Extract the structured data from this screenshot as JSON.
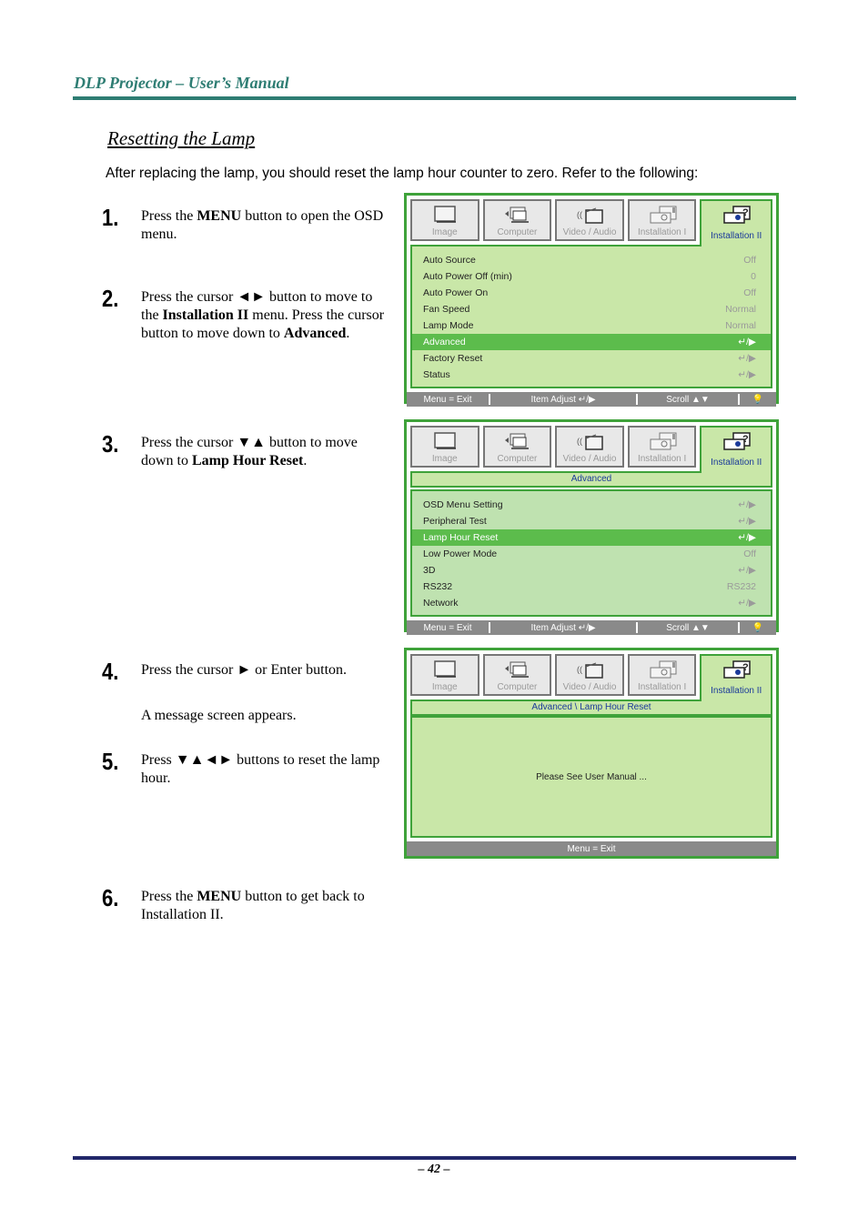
{
  "header": {
    "title": "DLP Projector – User’s Manual"
  },
  "section": {
    "title": "Resetting the Lamp",
    "intro": "After replacing the lamp, you should reset the lamp hour counter to zero. Refer to the following:"
  },
  "steps": [
    {
      "num": "1.",
      "parts": [
        "Press the ",
        "MENU",
        " button to open the OSD menu."
      ]
    },
    {
      "num": "2.",
      "parts": [
        "Press the cursor ◄► button to move to the ",
        "Installation II",
        " menu. Press the cursor button to move down to ",
        "Advanced",
        "."
      ]
    },
    {
      "num": "3.",
      "parts": [
        "Press the cursor ▼▲ button to move down to ",
        "Lamp Hour Reset",
        "."
      ]
    },
    {
      "num": "4.",
      "parts": [
        "Press the cursor ► or Enter button."
      ]
    },
    {
      "num": "",
      "parts": [
        "A message screen appears."
      ]
    },
    {
      "num": "5.",
      "parts": [
        "Press ▼▲◄► buttons to reset the lamp hour."
      ]
    },
    {
      "num": "6.",
      "parts": [
        "Press the ",
        "MENU",
        " button to get back to Installation II."
      ]
    }
  ],
  "osd": {
    "tabs": [
      {
        "label": "Image",
        "icon": "monitor-icon"
      },
      {
        "label": "Computer",
        "icon": "computer-icon"
      },
      {
        "label": "Video / Audio",
        "icon": "video-audio-icon"
      },
      {
        "label": "Installation I",
        "icon": "projector-icon"
      },
      {
        "label": "Installation II",
        "icon": "projector-help-icon",
        "active": true
      }
    ],
    "enter_glyph": "↵/▶",
    "footer": {
      "menu_exit": "Menu = Exit",
      "item_adjust": "Item Adjust ↵/▶",
      "scroll": "Scroll ▲▼",
      "lamp_icon": "💡"
    },
    "screen1": {
      "rows": [
        {
          "label": "Auto Source",
          "value": "Off"
        },
        {
          "label": "Auto Power Off (min)",
          "value": "0"
        },
        {
          "label": "Auto Power On",
          "value": "Off"
        },
        {
          "label": "Fan Speed",
          "value": "Normal"
        },
        {
          "label": "Lamp Mode",
          "value": "Normal"
        },
        {
          "label": "Advanced",
          "value": "↵/▶",
          "selected": true
        },
        {
          "label": "Factory Reset",
          "value": "↵/▶"
        },
        {
          "label": "Status",
          "value": "↵/▶"
        }
      ]
    },
    "screen2": {
      "breadcrumb": "Advanced",
      "rows": [
        {
          "label": "OSD Menu Setting",
          "value": "↵/▶"
        },
        {
          "label": "Peripheral Test",
          "value": "↵/▶"
        },
        {
          "label": "Lamp Hour Reset",
          "value": "↵/▶",
          "selected": true
        },
        {
          "label": "Low Power Mode",
          "value": "Off"
        },
        {
          "label": "3D",
          "value": "↵/▶"
        },
        {
          "label": "RS232",
          "value": "RS232"
        },
        {
          "label": "Network",
          "value": "↵/▶"
        }
      ]
    },
    "screen3": {
      "breadcrumb": "Advanced \\ Lamp Hour Reset",
      "message": "Please See User Manual ...",
      "footer": "Menu = Exit"
    }
  },
  "footer": {
    "page_number": "– 42 –"
  }
}
